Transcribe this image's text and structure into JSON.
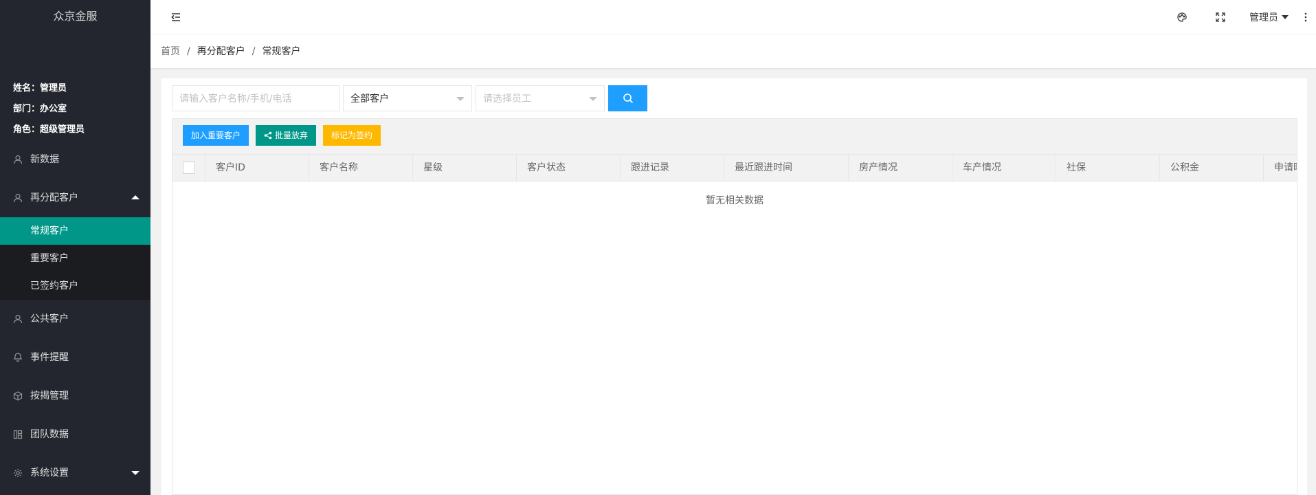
{
  "sidebar": {
    "logo": "众京金服",
    "user": {
      "name_label": "姓名：",
      "name": "管理员",
      "dept_label": "部门：",
      "dept": "办公室",
      "role_label": "角色：",
      "role": "超级管理员"
    },
    "items": [
      {
        "label": "新数据",
        "icon": "user-icon"
      },
      {
        "label": "再分配客户",
        "icon": "user-icon",
        "expanded": true,
        "children": [
          {
            "label": "常规客户",
            "active": true
          },
          {
            "label": "重要客户"
          },
          {
            "label": "已签约客户"
          }
        ]
      },
      {
        "label": "公共客户",
        "icon": "user-icon"
      },
      {
        "label": "事件提醒",
        "icon": "bell-icon"
      },
      {
        "label": "按揭管理",
        "icon": "cube-icon"
      },
      {
        "label": "团队数据",
        "icon": "template-icon"
      },
      {
        "label": "系统设置",
        "icon": "gear-icon",
        "expanded": false
      }
    ]
  },
  "header": {
    "user_name": "管理员"
  },
  "breadcrumb": {
    "home": "首页",
    "parent": "再分配客户",
    "current": "常规客户",
    "separator": "/"
  },
  "search": {
    "keyword_placeholder": "请输入客户名称/手机/电话",
    "customer_type": "全部客户",
    "employee_placeholder": "请选择员工"
  },
  "toolbar": {
    "add_important": "加入重要客户",
    "batch_abandon": "批量放弃",
    "mark_signed": "标记为签约"
  },
  "table": {
    "columns": [
      "客户ID",
      "客户名称",
      "星级",
      "客户状态",
      "跟进记录",
      "最近跟进时间",
      "房产情况",
      "车产情况",
      "社保",
      "公积金",
      "申请时间"
    ],
    "rows": [],
    "empty_text": "暂无相关数据"
  },
  "colors": {
    "sidebar_bg": "#23262e",
    "active_green": "#009688",
    "primary_blue": "#1e9fff",
    "warm_orange": "#ffb800"
  }
}
